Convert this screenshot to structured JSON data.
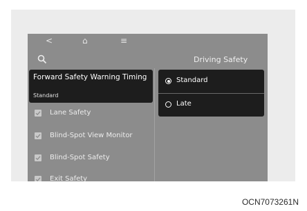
{
  "nav": {
    "back": "<",
    "home": "⌂",
    "menu": "≡"
  },
  "left": {
    "selected_item": {
      "title": "Forward Safety Warning Timing",
      "subtitle": "Standard"
    },
    "items": [
      {
        "label": "Lane Safety",
        "checked": true
      },
      {
        "label": "Blind-Spot View Monitor",
        "checked": true
      },
      {
        "label": "Blind-Spot Safety",
        "checked": true
      },
      {
        "label": "Exit Safety",
        "checked": true
      }
    ]
  },
  "right": {
    "title": "Driving Safety",
    "options": [
      {
        "label": "Standard",
        "selected": true
      },
      {
        "label": "Late",
        "selected": false
      }
    ]
  },
  "figure_code": "OCN7073261N",
  "colors": {
    "screen_bg": "#8c8c8c",
    "panel_bg": "#1d1d1d",
    "text": "#ffffff"
  }
}
